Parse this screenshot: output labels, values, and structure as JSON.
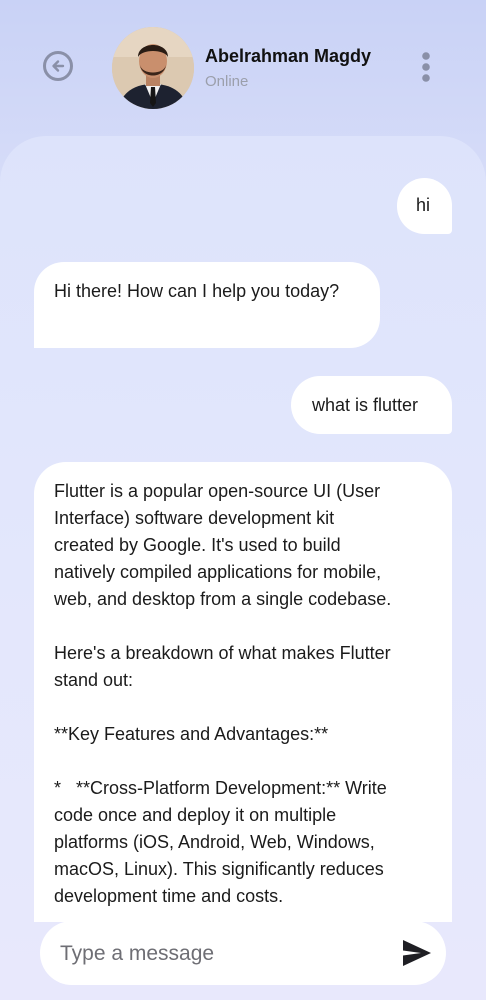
{
  "header": {
    "contact_name": "Abelrahman Magdy",
    "status": "Online",
    "back_icon": "back-arrow-circle-icon",
    "menu_icon": "more-vertical-icon"
  },
  "messages": [
    {
      "sender": "user",
      "text": "hi"
    },
    {
      "sender": "bot",
      "text": "Hi there! How can I help you today?"
    },
    {
      "sender": "user",
      "text": "what is flutter"
    },
    {
      "sender": "bot",
      "lines": [
        "Flutter is a popular open-source UI (User",
        "Interface) software development kit",
        "created by Google. It's used to build",
        "natively compiled applications for mobile,",
        "web, and desktop from a single codebase.",
        "",
        "Here's a breakdown of what makes Flutter",
        "stand out:",
        "",
        "**Key Features and Advantages:**",
        "",
        "*   **Cross-Platform Development:** Write",
        "code once and deploy it on multiple",
        "platforms (iOS, Android, Web, Windows,",
        "macOS, Linux). This significantly reduces",
        "development time and costs."
      ]
    }
  ],
  "composer": {
    "placeholder": "Type a message",
    "send_icon": "send-icon"
  },
  "colors": {
    "background_top": "#c9d2f6",
    "panel": "#e3e7fc",
    "bubble": "#ffffff",
    "icon": "#8a90a8",
    "status_text": "#9b9fab"
  }
}
